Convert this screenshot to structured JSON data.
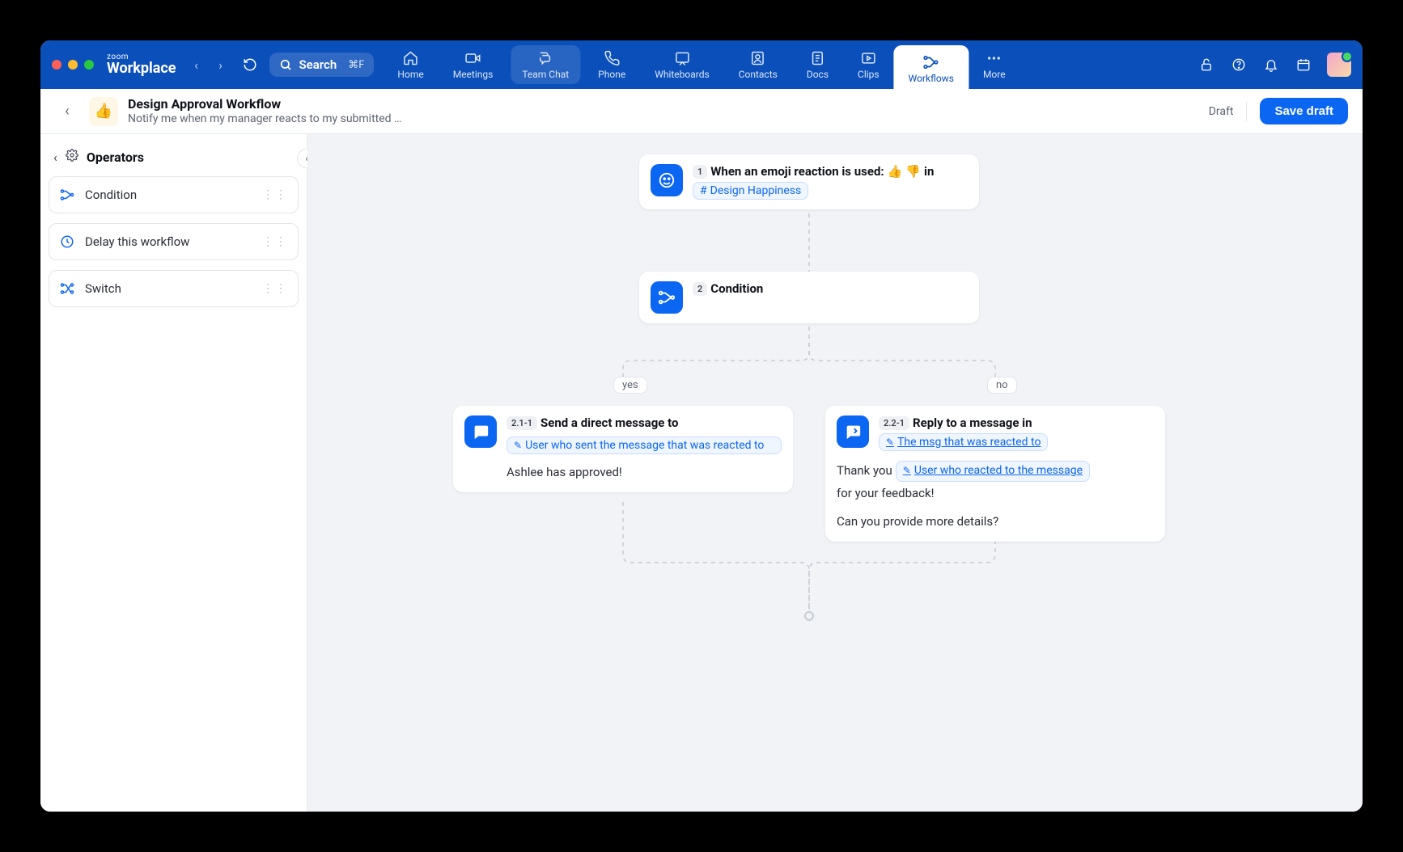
{
  "brand": {
    "top": "zoom",
    "bottom": "Workplace"
  },
  "search": {
    "placeholder": "Search",
    "shortcut": "⌘F"
  },
  "navTabs": [
    {
      "label": "Home"
    },
    {
      "label": "Meetings"
    },
    {
      "label": "Team Chat"
    },
    {
      "label": "Phone"
    },
    {
      "label": "Whiteboards"
    },
    {
      "label": "Contacts"
    },
    {
      "label": "Docs"
    },
    {
      "label": "Clips"
    },
    {
      "label": "Workflows"
    },
    {
      "label": "More"
    }
  ],
  "workflow": {
    "emoji": "👍",
    "title": "Design Approval Workflow",
    "subtitle": "Notify me when my manager reacts to my submitted …",
    "status": "Draft",
    "saveLabel": "Save draft"
  },
  "sidebar": {
    "title": "Operators",
    "items": [
      {
        "label": "Condition"
      },
      {
        "label": "Delay this workflow"
      },
      {
        "label": "Switch"
      }
    ]
  },
  "canvas": {
    "trigger": {
      "step": "1",
      "textBefore": "When an emoji reaction is used:",
      "emoji1": "👍",
      "emoji2": "👎",
      "textAfter": "in",
      "channelChip": "Design Happiness"
    },
    "condition": {
      "step": "2",
      "label": "Condition"
    },
    "branchYes": "yes",
    "branchNo": "no",
    "yesNode": {
      "step": "2.1-1",
      "title": "Send a direct message to",
      "chip": "User who sent the message that was reacted to",
      "body": "Ashlee has approved!"
    },
    "noNode": {
      "step": "2.2-1",
      "title": "Reply to a message in",
      "chip": "The msg that was reacted to",
      "body1a": "Thank you",
      "body1chip": "User who reacted to the message",
      "body1b": "for your feedback!",
      "body2": "Can you provide more details?"
    }
  }
}
